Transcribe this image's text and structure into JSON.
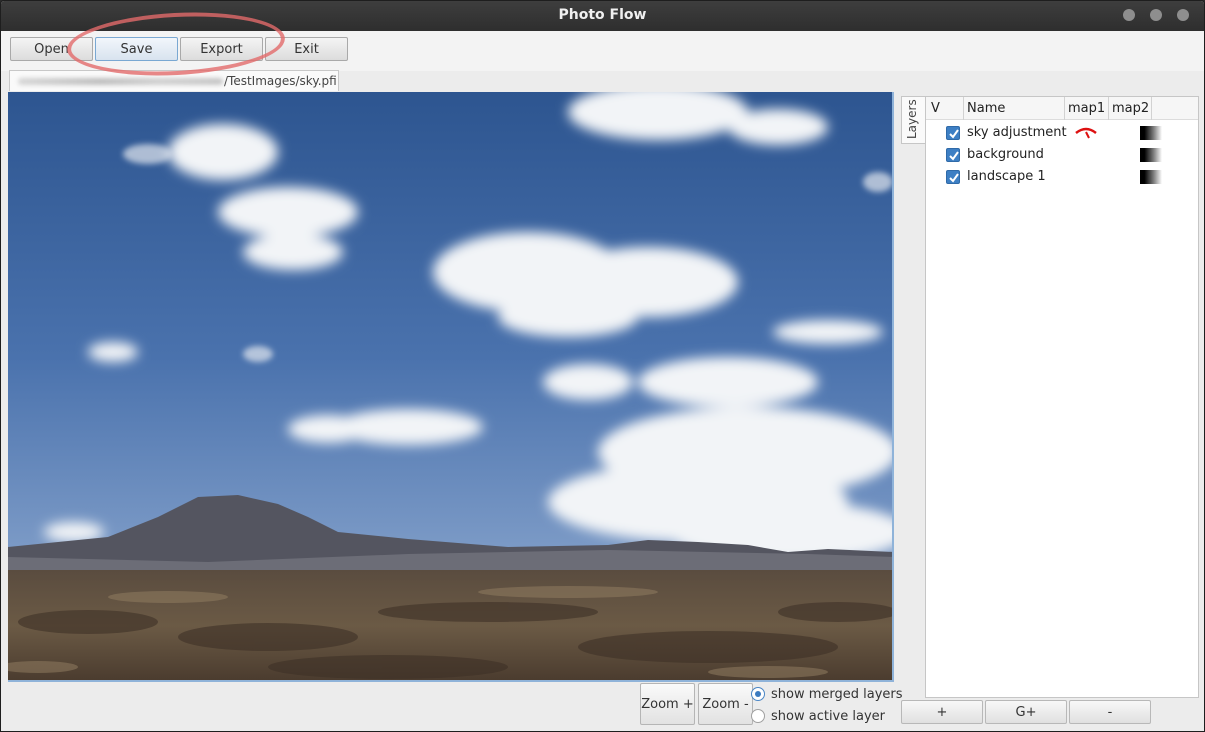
{
  "window": {
    "title": "Photo Flow"
  },
  "toolbar": {
    "open_label": "Open",
    "save_label": "Save",
    "export_label": "Export",
    "exit_label": "Exit"
  },
  "document_tab": {
    "path": "/TestImages/sky.pfi"
  },
  "zoom": {
    "zoom_in_label": "Zoom +",
    "zoom_out_label": "Zoom -"
  },
  "view_options": {
    "show_merged_label": "show merged layers",
    "show_active_label": "show active layer",
    "selected": "show merged layers"
  },
  "layers_panel": {
    "tab_label": "Layers",
    "columns": {
      "visible": "V",
      "name": "Name",
      "map1": "map1",
      "map2": "map2"
    },
    "layers": [
      {
        "name": "sky adjustment",
        "visible": true,
        "map1_icon": "red-gauge-icon",
        "map2_icon": "gradient-mask-icon"
      },
      {
        "name": "background",
        "visible": true,
        "map1_icon": "",
        "map2_icon": "gradient-mask-icon"
      },
      {
        "name": "landscape 1",
        "visible": true,
        "map1_icon": "",
        "map2_icon": "gradient-mask-icon"
      }
    ],
    "buttons": {
      "add_label": "+",
      "group_label": "G+",
      "remove_label": "-"
    }
  },
  "colors": {
    "annotation": "#e26a6a",
    "accent": "#3d7fc4",
    "titlebar": "#333333"
  }
}
